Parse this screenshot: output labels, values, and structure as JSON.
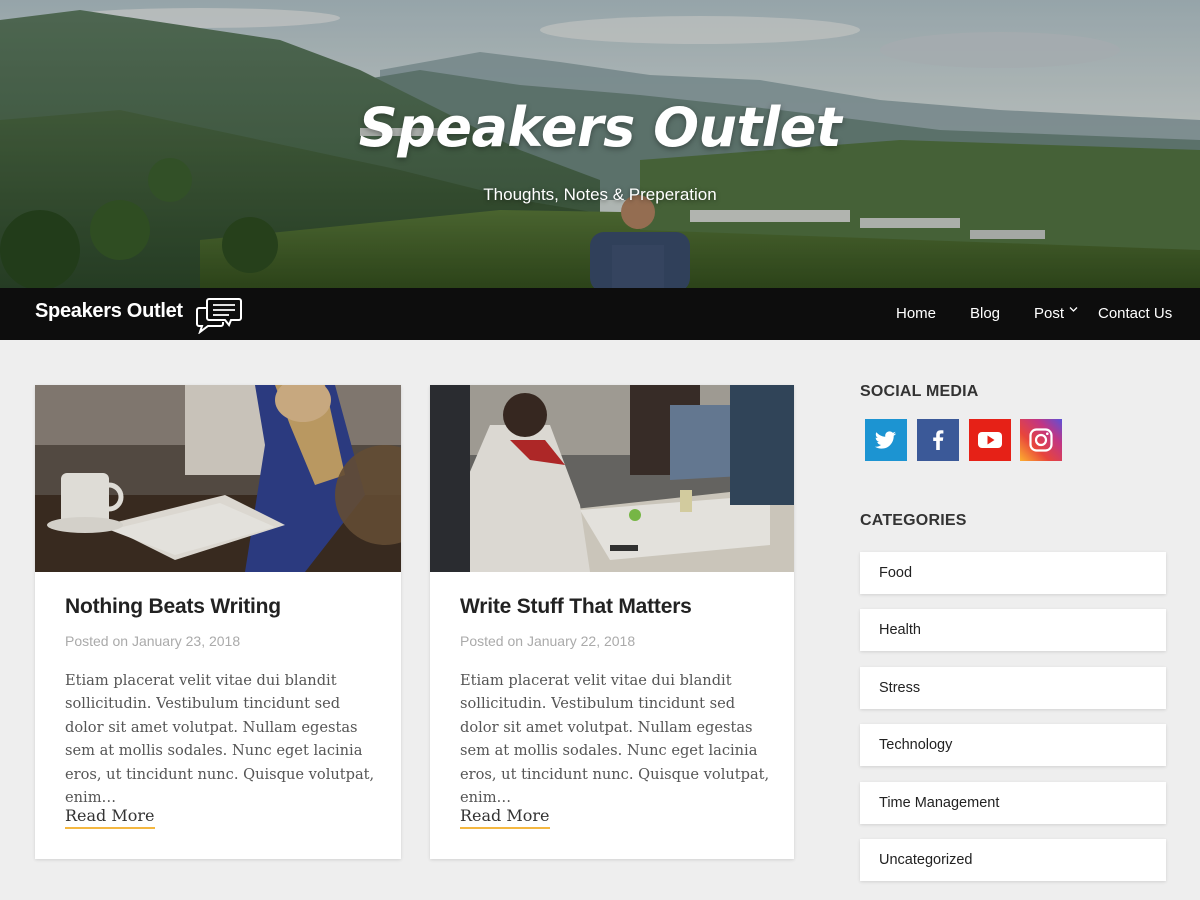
{
  "hero": {
    "title": "Speakers Outlet",
    "tagline": "Thoughts, Notes & Preperation"
  },
  "nav": {
    "brand": "Speakers Outlet",
    "brand_icon": "chat-bubbles-icon",
    "items": [
      {
        "label": "Home"
      },
      {
        "label": "Blog"
      },
      {
        "label": "Post",
        "has_dropdown": true
      },
      {
        "label": "Contact Us"
      }
    ]
  },
  "posts": [
    {
      "title": "Nothing Beats Writing",
      "date": "Posted on January 23, 2018",
      "excerpt": "Etiam placerat velit vitae dui blandit sollicitudin. Vestibulum tincidunt sed dolor sit amet volutpat. Nullam egestas sem at mollis sodales. Nunc eget lacinia eros, ut tincidunt nunc. Quisque volutpat, enim…",
      "read_more": "Read More"
    },
    {
      "title": "Write Stuff That Matters",
      "date": "Posted on January 22, 2018",
      "excerpt": "Etiam placerat velit vitae dui blandit sollicitudin. Vestibulum tincidunt sed dolor sit amet volutpat. Nullam egestas sem at mollis sodales. Nunc eget lacinia eros, ut tincidunt nunc. Quisque volutpat, enim…",
      "read_more": "Read More"
    }
  ],
  "sidebar": {
    "social_heading": "SOCIAL MEDIA",
    "social": [
      {
        "icon": "twitter-icon",
        "color": "#1c94d2"
      },
      {
        "icon": "facebook-icon",
        "color": "#3b5998"
      },
      {
        "icon": "youtube-icon",
        "color": "#e62117"
      },
      {
        "icon": "instagram-icon",
        "color": "#c13584"
      }
    ],
    "categories_heading": "CATEGORIES",
    "categories": [
      "Food",
      "Health",
      "Stress",
      "Technology",
      "Time Management",
      "Uncategorized"
    ]
  },
  "colors": {
    "nav_bg": "#0d0d0d",
    "page_bg": "#eeeeee",
    "accent_underline": "#f4b740"
  }
}
